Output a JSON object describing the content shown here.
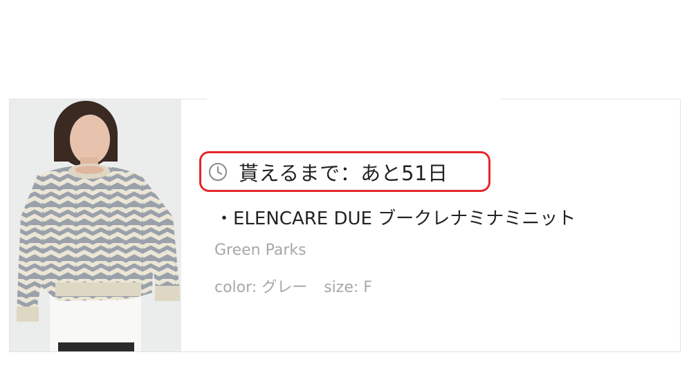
{
  "gift_item": {
    "countdown_icon": "clock-icon",
    "countdown_text": "貰えるまで：あと51日",
    "product_name": "・ELENCARE DUE ブークレナミナミニット",
    "brand": "Green Parks",
    "color_text": "color: グレー",
    "size_text": "size: F",
    "highlight_color": "#e4262b"
  }
}
